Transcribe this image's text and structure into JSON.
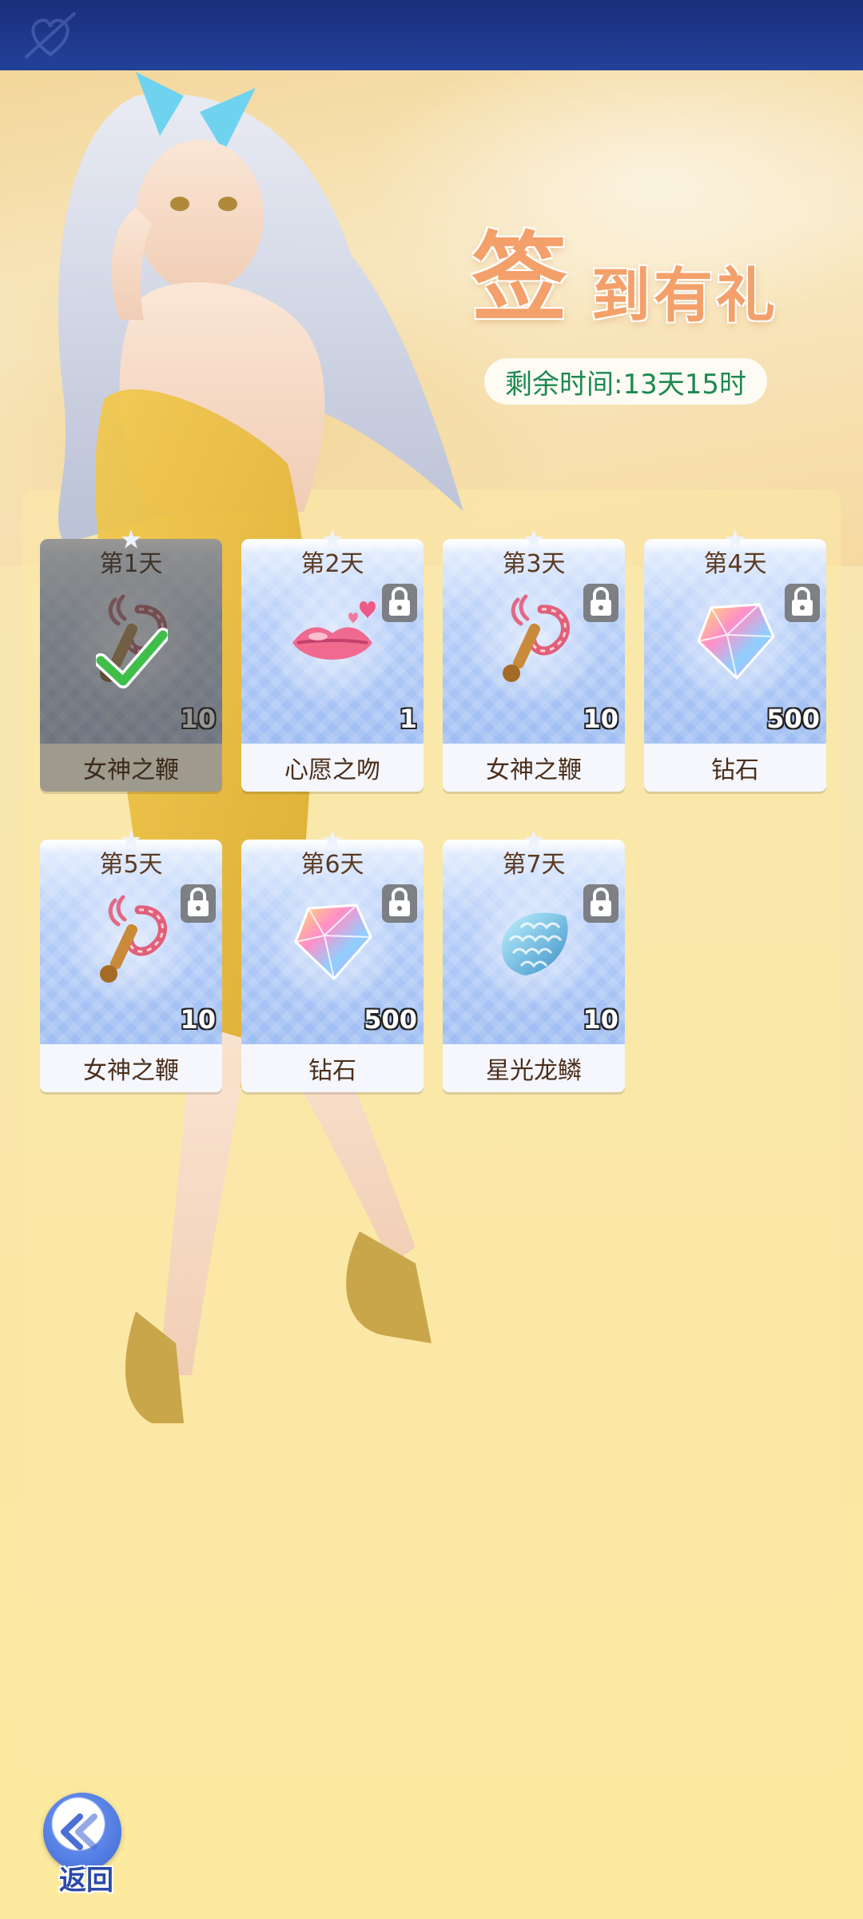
{
  "header": {
    "title_big": "签",
    "title_rest": "到有礼"
  },
  "timer": {
    "label": "剩余时间:",
    "value": "13天15时"
  },
  "days": [
    {
      "day": "第1天",
      "item": "女神之鞭",
      "qty": "10",
      "icon": "whip-icon",
      "claimed": true,
      "locked": false
    },
    {
      "day": "第2天",
      "item": "心愿之吻",
      "qty": "1",
      "icon": "kiss-lips-icon",
      "claimed": false,
      "locked": true
    },
    {
      "day": "第3天",
      "item": "女神之鞭",
      "qty": "10",
      "icon": "whip-icon",
      "claimed": false,
      "locked": true
    },
    {
      "day": "第4天",
      "item": "钻石",
      "qty": "500",
      "icon": "diamond-icon",
      "claimed": false,
      "locked": true
    },
    {
      "day": "第5天",
      "item": "女神之鞭",
      "qty": "10",
      "icon": "whip-icon",
      "claimed": false,
      "locked": true
    },
    {
      "day": "第6天",
      "item": "钻石",
      "qty": "500",
      "icon": "diamond-icon",
      "claimed": false,
      "locked": true
    },
    {
      "day": "第7天",
      "item": "星光龙鳞",
      "qty": "10",
      "icon": "dragon-scale-icon",
      "claimed": false,
      "locked": true
    }
  ],
  "footer": {
    "back_label": "返回"
  },
  "colors": {
    "title": "#f4a06a",
    "timer_text": "#1c8a50",
    "back": "#2b4aa8"
  }
}
